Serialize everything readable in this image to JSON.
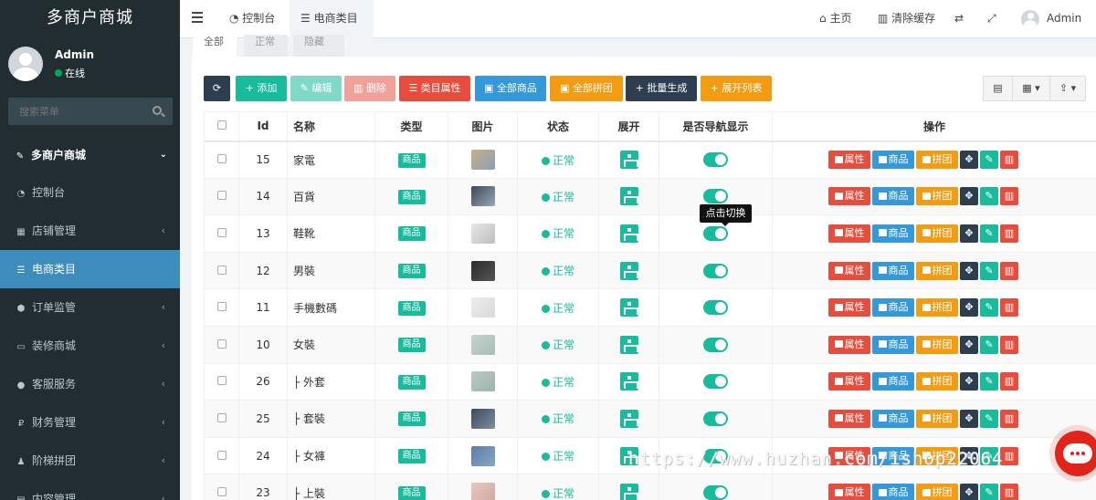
{
  "brand": "多商户商城",
  "user": {
    "name": "Admin",
    "status": "在线"
  },
  "search": {
    "placeholder": "搜索菜单"
  },
  "menu": {
    "header": "多商户商城",
    "items": [
      {
        "label": "控制台",
        "icon": "dashboard-icon"
      },
      {
        "label": "店铺管理",
        "icon": "store-icon"
      },
      {
        "label": "电商类目",
        "icon": "list-icon"
      },
      {
        "label": "订单监管",
        "icon": "cube-icon"
      },
      {
        "label": "装修商城",
        "icon": "monitor-icon"
      },
      {
        "label": "客服服务",
        "icon": "chat-icon"
      },
      {
        "label": "财务管理",
        "icon": "rupee-icon"
      },
      {
        "label": "阶梯拼团",
        "icon": "users-icon"
      },
      {
        "label": "内容管理",
        "icon": "file-icon"
      }
    ]
  },
  "topbar": {
    "tabs": [
      "控制台",
      "电商类目"
    ],
    "home": "主页",
    "clear_cache": "清除缓存",
    "user": "Admin"
  },
  "filter_tabs": [
    "全部",
    "正常",
    "隐藏"
  ],
  "toolbar": {
    "add": "添加",
    "edit": "编辑",
    "delete": "删除",
    "attr": "类目属性",
    "all_goods": "全部商品",
    "all_group": "全部拼团",
    "batch": "批量生成",
    "expand": "展开列表"
  },
  "table": {
    "headers": [
      "Id",
      "名称",
      "类型",
      "图片",
      "状态",
      "展开",
      "是否导航显示",
      "操作"
    ],
    "type_label": "商品",
    "status_label": "正常",
    "ops": {
      "attr": "属性",
      "goods": "商品",
      "group": "拼团"
    },
    "rows": [
      {
        "id": "15",
        "name": "家電"
      },
      {
        "id": "14",
        "name": "百貨"
      },
      {
        "id": "13",
        "name": "鞋靴"
      },
      {
        "id": "12",
        "name": "男裝"
      },
      {
        "id": "11",
        "name": "手機數碼"
      },
      {
        "id": "10",
        "name": "女裝"
      },
      {
        "id": "26",
        "name": "├ 外套"
      },
      {
        "id": "25",
        "name": "├ 套裝"
      },
      {
        "id": "24",
        "name": "├ 女褲"
      },
      {
        "id": "23",
        "name": "├ 上裝"
      }
    ]
  },
  "tooltip": "点击切换",
  "watermark": "https://www.huzhan.com/ishop22064",
  "colors": {
    "sidebar": "#222d32",
    "active": "#3c8dbc",
    "success": "#18bc9c",
    "danger": "#e74c3c",
    "primary": "#3498db",
    "warning": "#f39c12"
  }
}
